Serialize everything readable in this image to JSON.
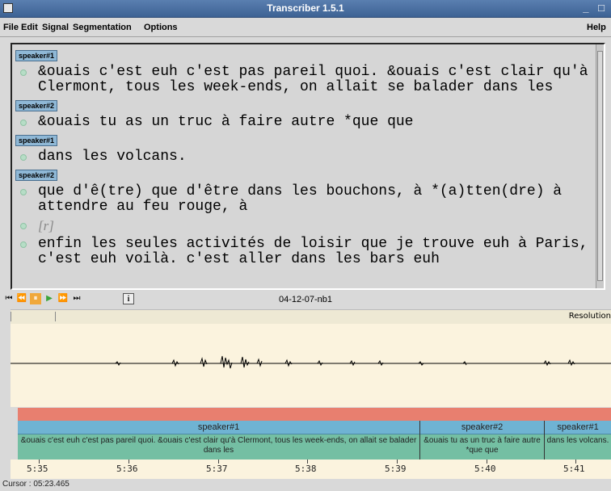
{
  "window": {
    "title": "Transcriber 1.5.1",
    "controls": "_ □"
  },
  "menu": {
    "file": "File",
    "edit": "Edit",
    "signal": "Signal",
    "segmentation": "Segmentation",
    "options": "Options",
    "help": "Help"
  },
  "editor": {
    "turns": [
      {
        "speaker": "speaker#1",
        "text": "&ouais c'est euh c'est pas pareil quoi. &ouais c'est clair qu'à Clermont, tous les week-ends, on allait se balader dans les"
      },
      {
        "speaker": "speaker#2",
        "text": "&ouais tu as un truc à faire autre *que que"
      },
      {
        "speaker": "speaker#1",
        "text": "dans les volcans."
      },
      {
        "speaker": "speaker#2",
        "text": " que d'ê(tre) que d'être dans les bouchons, à *(a)tten(dre) à attendre au feu rouge, à"
      }
    ],
    "noise_event": "[r]",
    "last_line": "enfin les seules activités de loisir que je trouve euh à Paris, c'est euh voilà. c'est aller dans les bars euh"
  },
  "transport": {
    "buttons": [
      "⏮",
      "⏪",
      "⏸",
      "▶",
      "⏩",
      "⏭"
    ],
    "info_label": "i",
    "filename": "04-12-07-nb1"
  },
  "ruler": {
    "resolution_label": "Resolution"
  },
  "segments": [
    {
      "speaker": "speaker#1",
      "text": "&ouais c'est euh c'est pas pareil quoi. &ouais c'est clair qu'à Clermont, tous les week-ends, on allait se balader dans les"
    },
    {
      "speaker": "speaker#2",
      "text": "&ouais tu as un truc à faire autre *que que"
    },
    {
      "speaker": "speaker#1",
      "text": "dans les volcans."
    }
  ],
  "time_axis": [
    "5:35",
    "5:36",
    "5:37",
    "5:38",
    "5:39",
    "5:40",
    "5:41"
  ],
  "status": {
    "cursor": "Cursor : 05:23.465"
  },
  "colors": {
    "titlebar": "#4a6fa5",
    "speaker_tag": "#8fb8d6",
    "segment_speaker": "#6fb3d3",
    "segment_text": "#74bfa3",
    "turn_marker": "#f07f6f",
    "waveform_bg": "#fbf3de"
  }
}
